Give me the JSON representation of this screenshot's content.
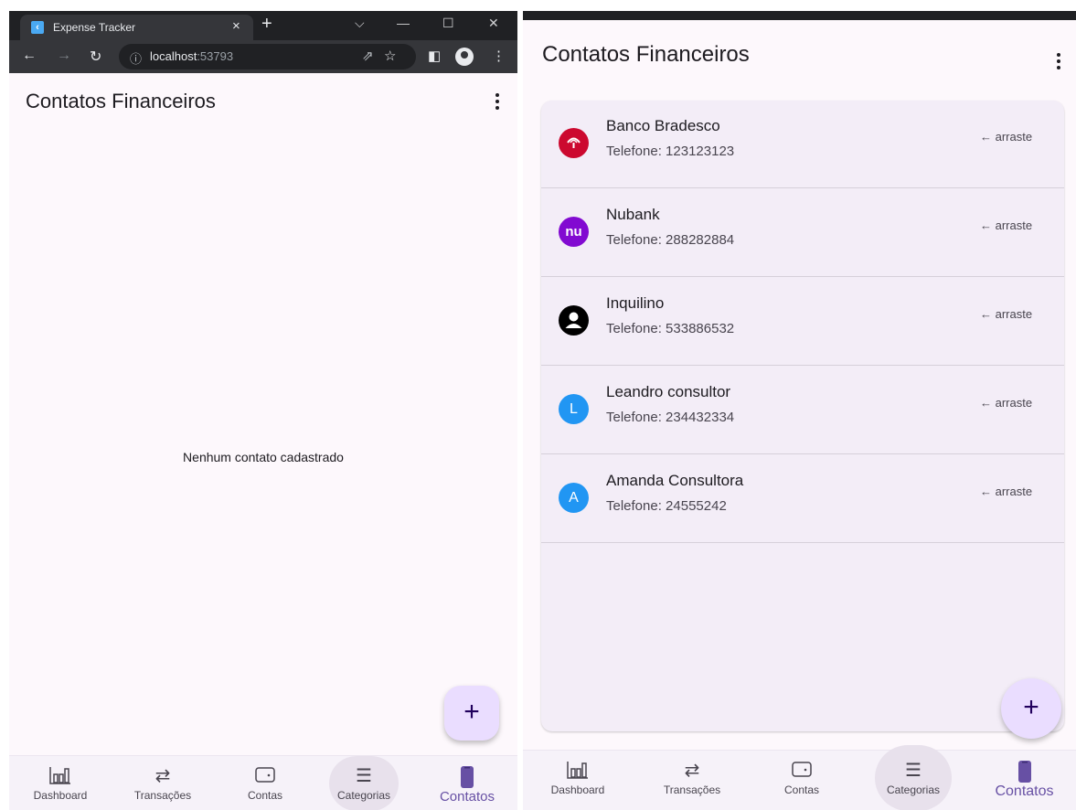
{
  "browser": {
    "tab_title": "Expense Tracker",
    "tab_close": "×",
    "new_tab": "+",
    "url_host": "localhost",
    "url_port": ":53793",
    "window_controls": {
      "minimize": "—",
      "maximize": "☐",
      "close": "✕",
      "dropdown": "⌵"
    }
  },
  "screen_empty": {
    "title": "Contatos Financeiros",
    "empty_message": "Nenhum contato cadastrado",
    "fab_label": "+"
  },
  "screen_list": {
    "title": "Contatos Financeiros",
    "fab_label": "+",
    "contacts": [
      {
        "name": "Banco Bradesco",
        "phone": "Telefone: 123123123",
        "swipe_hint": "← arraste",
        "avatar_text": "",
        "avatar_icon": "bradesco-logo-icon",
        "avatar_color": "#cc092f"
      },
      {
        "name": "Nubank",
        "phone": "Telefone: 288282884",
        "swipe_hint": "← arraste",
        "avatar_text": "nu",
        "avatar_icon": "nubank-logo-icon",
        "avatar_color": "#820ad1"
      },
      {
        "name": "Inquilino",
        "phone": "Telefone: 533886532",
        "swipe_hint": "← arraste",
        "avatar_text": "",
        "avatar_icon": "person-icon",
        "avatar_color": "#000000"
      },
      {
        "name": "Leandro consultor",
        "phone": "Telefone: 234432334",
        "swipe_hint": "← arraste",
        "avatar_text": "L",
        "avatar_icon": "",
        "avatar_color": "#2196f3"
      },
      {
        "name": "Amanda Consultora",
        "phone": "Telefone: 24555242",
        "swipe_hint": "← arraste",
        "avatar_text": "A",
        "avatar_icon": "",
        "avatar_color": "#2196f3"
      }
    ]
  },
  "nav": {
    "items": [
      {
        "label": "Dashboard",
        "icon": "bar-chart-icon"
      },
      {
        "label": "Transações",
        "icon": "swap-arrows-icon"
      },
      {
        "label": "Contas",
        "icon": "wallet-icon"
      },
      {
        "label": "Categorias",
        "icon": "list-icon"
      },
      {
        "label": "Contatos",
        "icon": "phone-icon"
      }
    ],
    "active": "Contatos",
    "active_color": "#6750a4"
  },
  "colors": {
    "background": "#fdf8fc",
    "fab": "#eaddff",
    "card": "#f3edf7"
  }
}
